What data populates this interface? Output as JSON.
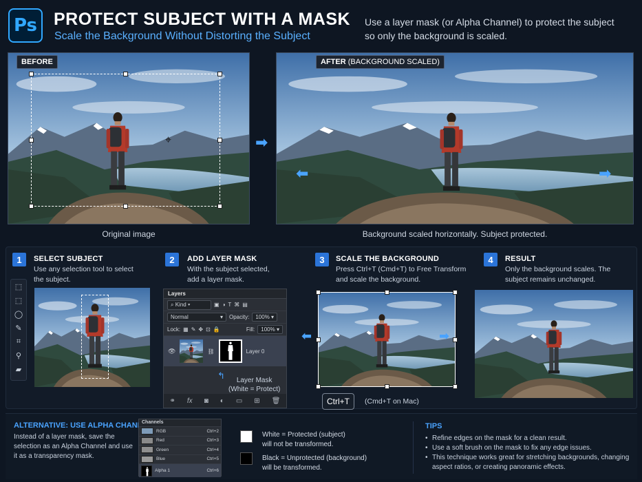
{
  "header": {
    "logo": "Ps",
    "title": "PROTECT SUBJECT WITH A MASK",
    "subtitle": "Scale the Background Without Distorting the Subject",
    "intro": "Use a layer mask (or Alpha Channel) to protect the subject so only the background is scaled."
  },
  "before": {
    "tag": "BEFORE",
    "caption": "Original image"
  },
  "after": {
    "tag": "AFTER",
    "tag_suffix": "(BACKGROUND SCALED)",
    "caption": "Background scaled horizontally. Subject protected."
  },
  "steps": [
    {
      "num": "1",
      "title": "SELECT SUBJECT",
      "desc": "Use any selection tool to select the subject."
    },
    {
      "num": "2",
      "title": "ADD LAYER MASK",
      "desc": "With the subject selected, add a layer mask."
    },
    {
      "num": "3",
      "title": "SCALE THE BACKGROUND",
      "desc": "Press Ctrl+T (Cmd+T) to Free Transform and scale the background."
    },
    {
      "num": "4",
      "title": "RESULT",
      "desc": "Only the background scales. The subject remains unchanged."
    }
  ],
  "layers_panel": {
    "title": "Layers",
    "kind": "Kind",
    "blend": "Normal",
    "opacity_label": "Opacity:",
    "opacity": "100%",
    "lock_label": "Lock:",
    "fill_label": "Fill:",
    "fill": "100%",
    "layer_name": "Layer 0",
    "annotation_line1": "Layer Mask",
    "annotation_line2": "(White = Protect)"
  },
  "transform": {
    "key": "Ctrl+T",
    "mac_note": "(Cmd+T on Mac)"
  },
  "alternative": {
    "title": "ALTERNATIVE: USE ALPHA CHANNEL",
    "desc": "Instead of a layer mask, save the selection as an Alpha Channel and use it as a transparency mask."
  },
  "channels_panel": {
    "title": "Channels",
    "rows": [
      {
        "name": "RGB",
        "shortcut": "Ctrl+2"
      },
      {
        "name": "Red",
        "shortcut": "Ctrl+3"
      },
      {
        "name": "Green",
        "shortcut": "Ctrl+4"
      },
      {
        "name": "Blue",
        "shortcut": "Ctrl+5"
      },
      {
        "name": "Alpha 1",
        "shortcut": "Ctrl+6"
      }
    ]
  },
  "legend": {
    "white_line1": "White = Protected (subject)",
    "white_line2": "will not be transformed.",
    "black_line1": "Black = Unprotected (background)",
    "black_line2": "will be transformed."
  },
  "tips": {
    "title": "TIPS",
    "items": [
      "Refine edges on the mask for a clean result.",
      "Use a soft brush on the mask to fix any edge issues.",
      "This technique works great for stretching backgrounds, changing aspect ratios, or creating panoramic effects."
    ]
  },
  "colors": {
    "accent": "#2b74d8",
    "accent_light": "#4aa3ff",
    "ps_blue": "#31a8ff",
    "bg": "#0e1622"
  }
}
